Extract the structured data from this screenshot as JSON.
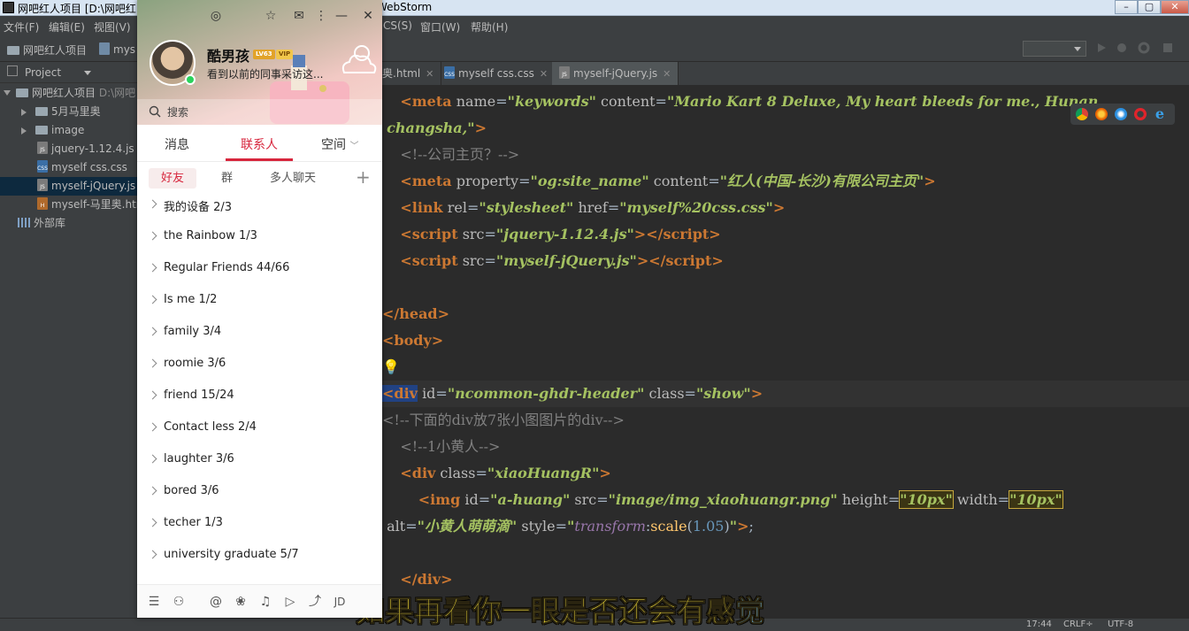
{
  "webstorm": {
    "title_left": "网吧红人项目 [D:\\网吧红",
    "title_right": "WebStorm",
    "menu": [
      "文件(F)",
      "编辑(E)",
      "视图(V)",
      "CS(S)",
      "窗口(W)",
      "帮助(H)"
    ],
    "breadcrumb": [
      "网吧红人项目",
      "mys"
    ],
    "project_label": "Project",
    "tree": [
      {
        "label": "网吧红人项目",
        "extra": "D:\\网吧",
        "type": "root"
      },
      {
        "label": "5月马里奥",
        "type": "folder"
      },
      {
        "label": "image",
        "type": "folder"
      },
      {
        "label": "jquery-1.12.4.js",
        "type": "js"
      },
      {
        "label": "myself css.css",
        "type": "css"
      },
      {
        "label": "myself-jQuery.js",
        "type": "js"
      },
      {
        "label": "myself-马里奥.htm",
        "type": "html"
      },
      {
        "label": "外部库",
        "type": "lib"
      }
    ],
    "tabs": [
      "奥.html",
      "myself css.css",
      "myself-jQuery.js"
    ],
    "status": {
      "left": "",
      "time": "17:44",
      "crlf": "CRLF÷",
      "enc": "UTF-8"
    }
  },
  "editor": {
    "l1_attr1": "name",
    "l1_val1": "\"keywords\"",
    "l1_attr2": "content",
    "l1_val2": "\"Mario Kart 8 Deluxe, My heart bleeds for me., Hunan",
    "l2": "changsha,\"",
    "l3": "<!--公司主页？-->",
    "l4_attr1": "property",
    "l4_val1": "\"og:site_name\"",
    "l4_val2": "\"红人(中国-长沙)有限公司主页\"",
    "l5_val1": "\"stylesheet\"",
    "l5_val2": "\"myself%20css.css\"",
    "l6_val": "\"jquery-1.12.4.js\"",
    "l7_val": "\"myself-jQuery.js\"",
    "l10_id": "\"ncommon-ghdr-header\"",
    "l10_class": "\"show\"",
    "l11": "<!--下面的div放7张小图图片的div-->",
    "l12": "<!--1小黄人-->",
    "l13_class": "\"xiaoHuangR\"",
    "l14_id": "\"a-huang\"",
    "l14_src": "\"image/img_xiaohuangr.png\"",
    "l14_h": "\"10px\"",
    "l14_w": "\"10px\"",
    "l15_alt": "\"小黄人萌萌滴\"",
    "l15_fn": "transform",
    "l15_scale": "scale",
    "l15_num": "1.05"
  },
  "subtitle": {
    "main": "如果再看你一眼是否还会有感",
    "last": "觉"
  },
  "qq": {
    "name": "酷男孩",
    "level_badge": "LV63",
    "vip_badge": "VIP",
    "signature": "看到以前的同事采访这...",
    "search_placeholder": "搜索",
    "tabs": [
      "消息",
      "联系人",
      "空间"
    ],
    "subtabs": [
      "好友",
      "群",
      "多人聊天"
    ],
    "groups": [
      "我的设备  2/3",
      "the Rainbow  1/3",
      "Regular Friends  44/66",
      "Is me  1/2",
      "family  3/4",
      "roomie  3/6",
      "friend  15/24",
      "Contact less  2/4",
      " laughter  3/6",
      "bored  3/6",
      "techer  1/3",
      "university graduate  5/7"
    ]
  }
}
